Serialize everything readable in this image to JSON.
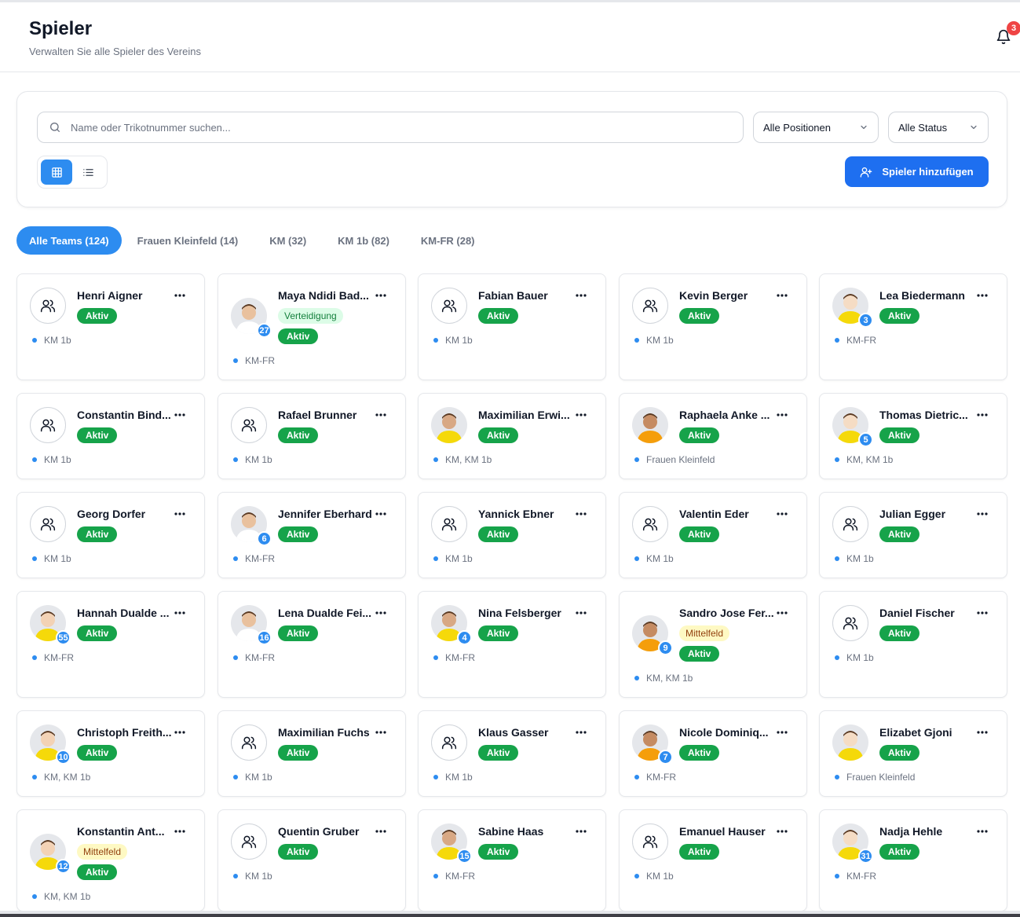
{
  "header": {
    "title": "Spieler",
    "subtitle": "Verwalten Sie alle Spieler des Vereins",
    "notification_count": "3"
  },
  "filters": {
    "search_placeholder": "Name oder Trikotnummer suchen...",
    "position_select": "Alle Positionen",
    "status_select": "Alle Status",
    "add_button": "Spieler hinzufügen",
    "view_mode": "grid"
  },
  "tabs": [
    {
      "label": "Alle Teams (124)",
      "active": true
    },
    {
      "label": "Frauen Kleinfeld (14)",
      "active": false
    },
    {
      "label": "KM (32)",
      "active": false
    },
    {
      "label": "KM 1b (82)",
      "active": false
    },
    {
      "label": "KM-FR (28)",
      "active": false
    }
  ],
  "colors": {
    "accent": "#2d8cf0",
    "primary_button": "#1e6ff0",
    "status_active": "#16a34a",
    "position_defense_bg": "#dcfce7",
    "position_midfield_bg": "#fef9c3",
    "notification": "#ef4444"
  },
  "players": [
    {
      "name": "Henri Aigner",
      "status": "Aktiv",
      "teams": "KM 1b",
      "avatar": "placeholder-user-icon"
    },
    {
      "name": "Maya Ndidi Bad...",
      "position": "Verteidigung",
      "status": "Aktiv",
      "teams": "KM-FR",
      "avatar": "photo",
      "number": "27"
    },
    {
      "name": "Fabian Bauer",
      "status": "Aktiv",
      "teams": "KM 1b",
      "avatar": "placeholder-user-icon"
    },
    {
      "name": "Kevin Berger",
      "status": "Aktiv",
      "teams": "KM 1b",
      "avatar": "placeholder-user-icon"
    },
    {
      "name": "Lea Biedermann",
      "status": "Aktiv",
      "teams": "KM-FR",
      "avatar": "photo",
      "number": "3"
    },
    {
      "name": "Constantin Bind...",
      "status": "Aktiv",
      "teams": "KM 1b",
      "avatar": "placeholder-user-icon"
    },
    {
      "name": "Rafael Brunner",
      "status": "Aktiv",
      "teams": "KM 1b",
      "avatar": "placeholder-user-icon"
    },
    {
      "name": "Maximilian Erwi...",
      "status": "Aktiv",
      "teams": "KM, KM 1b",
      "avatar": "photo"
    },
    {
      "name": "Raphaela Anke ...",
      "status": "Aktiv",
      "teams": "Frauen Kleinfeld",
      "avatar": "photo"
    },
    {
      "name": "Thomas Dietric...",
      "status": "Aktiv",
      "teams": "KM, KM 1b",
      "avatar": "photo",
      "number": "5"
    },
    {
      "name": "Georg Dorfer",
      "status": "Aktiv",
      "teams": "KM 1b",
      "avatar": "placeholder-user-icon"
    },
    {
      "name": "Jennifer Eberhard",
      "status": "Aktiv",
      "teams": "KM-FR",
      "avatar": "photo",
      "number": "6"
    },
    {
      "name": "Yannick Ebner",
      "status": "Aktiv",
      "teams": "KM 1b",
      "avatar": "placeholder-user-icon"
    },
    {
      "name": "Valentin Eder",
      "status": "Aktiv",
      "teams": "KM 1b",
      "avatar": "placeholder-user-icon"
    },
    {
      "name": "Julian Egger",
      "status": "Aktiv",
      "teams": "KM 1b",
      "avatar": "placeholder-user-icon"
    },
    {
      "name": "Hannah Dualde ...",
      "status": "Aktiv",
      "teams": "KM-FR",
      "avatar": "photo",
      "number": "55"
    },
    {
      "name": "Lena Dualde Fei...",
      "status": "Aktiv",
      "teams": "KM-FR",
      "avatar": "photo",
      "number": "16"
    },
    {
      "name": "Nina Felsberger",
      "status": "Aktiv",
      "teams": "KM-FR",
      "avatar": "photo",
      "number": "4"
    },
    {
      "name": "Sandro Jose Fer...",
      "position": "Mittelfeld",
      "status": "Aktiv",
      "teams": "KM, KM 1b",
      "avatar": "photo",
      "number": "9"
    },
    {
      "name": "Daniel Fischer",
      "status": "Aktiv",
      "teams": "KM 1b",
      "avatar": "placeholder-user-icon"
    },
    {
      "name": "Christoph Freith...",
      "status": "Aktiv",
      "teams": "KM, KM 1b",
      "avatar": "photo",
      "number": "10"
    },
    {
      "name": "Maximilian Fuchs",
      "status": "Aktiv",
      "teams": "KM 1b",
      "avatar": "placeholder-user-icon"
    },
    {
      "name": "Klaus Gasser",
      "status": "Aktiv",
      "teams": "KM 1b",
      "avatar": "placeholder-user-icon"
    },
    {
      "name": "Nicole Dominiq...",
      "status": "Aktiv",
      "teams": "KM-FR",
      "avatar": "photo",
      "number": "7"
    },
    {
      "name": "Elizabet Gjoni",
      "status": "Aktiv",
      "teams": "Frauen Kleinfeld",
      "avatar": "photo"
    },
    {
      "name": "Konstantin Ant...",
      "position": "Mittelfeld",
      "status": "Aktiv",
      "teams": "KM, KM 1b",
      "avatar": "photo",
      "number": "12"
    },
    {
      "name": "Quentin Gruber",
      "status": "Aktiv",
      "teams": "KM 1b",
      "avatar": "placeholder-user-icon"
    },
    {
      "name": "Sabine Haas",
      "status": "Aktiv",
      "teams": "KM-FR",
      "avatar": "photo",
      "number": "15"
    },
    {
      "name": "Emanuel Hauser",
      "status": "Aktiv",
      "teams": "KM 1b",
      "avatar": "placeholder-user-icon"
    },
    {
      "name": "Nadja Hehle",
      "status": "Aktiv",
      "teams": "KM-FR",
      "avatar": "photo",
      "number": "31"
    }
  ]
}
